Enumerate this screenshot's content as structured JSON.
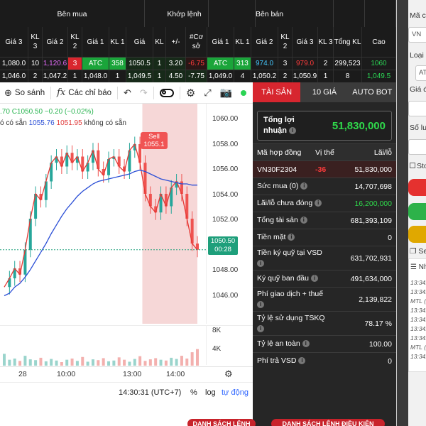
{
  "board": {
    "groups": {
      "buy": "Bên mua",
      "match": "Khớp lệnh",
      "sell": "Bên bán"
    },
    "headers": {
      "b_gia3": "Giá 3",
      "b_kl3": "KL 3",
      "b_gia2": "Giá 2",
      "b_kl2": "KL 2",
      "b_gia1": "Giá 1",
      "b_kl1": "KL 1",
      "m_gia": "Giá",
      "m_kl": "KL",
      "m_chg": "+/-",
      "m_pct": "#Cơ sở",
      "s_gia1": "Giá 1",
      "s_kl1": "KL 1",
      "s_gia2": "Giá 2",
      "s_kl2": "KL 2",
      "s_gia3": "Giá 3",
      "s_kl3": "KL 3",
      "total": "Tổng KL",
      "high": "Cao"
    },
    "rows": [
      {
        "b_gia3": "1,080.0",
        "b_kl3": "10",
        "b_gia2": "1,120.6",
        "b_kl2": "3",
        "b_gia1": "ATC",
        "b_kl1": "358",
        "m_gia": "1050.5",
        "m_kl": "1",
        "m_chg": "3.20",
        "m_pct": "-6.75",
        "s_gia1": "ATC",
        "s_kl1": "313",
        "s_gia2": "974.0",
        "s_kl2": "3",
        "s_gia3": "979.0",
        "s_kl3": "2",
        "total": "299,523",
        "high": "1060"
      },
      {
        "b_gia3": "1,046.0",
        "b_kl3": "2",
        "b_gia2": "1,047.2",
        "b_kl2": "1",
        "b_gia1": "1,048.0",
        "b_kl1": "1",
        "m_gia": "1,049.5",
        "m_kl": "1",
        "m_chg": "4.50",
        "m_pct": "-7.75",
        "s_gia1": "1,049.0",
        "s_kl1": "4",
        "s_gia2": "1,050.2",
        "s_kl2": "2",
        "s_gia3": "1,050.9",
        "s_kl3": "1",
        "total": "8",
        "high": "1,049.5"
      }
    ]
  },
  "chart": {
    "toolbar": {
      "compare": "So sánh",
      "indicators": "Các chỉ báo"
    },
    "legend1": {
      "prefix": ".70",
      "close": "C1050.50",
      "change": "−0.20 (−0.02%)"
    },
    "legend2": {
      "left": "ó có sẵn",
      "ma": "1055.76",
      "ma2": "1051.95",
      "right": "không có sẵn"
    },
    "sell_marker": {
      "label": "Sell",
      "price": "1055.1"
    },
    "y_ticks": [
      "1060.00",
      "1058.00",
      "1056.00",
      "1054.00",
      "1052.00",
      "1050.00",
      "1048.00",
      "1046.00"
    ],
    "last_price": "1050.50",
    "countdown": "00:28",
    "vol_ticks": [
      "8K",
      "4K"
    ],
    "x_ticks": [
      "28",
      "10:00",
      "13:00",
      "14:00"
    ],
    "time": "14:30:31 (UTC+7)",
    "pct": "%",
    "log": "log",
    "auto": "tự động"
  },
  "chart_data": {
    "type": "line",
    "title": "",
    "ylim": [
      1045,
      1061
    ],
    "x_ticks": [
      "28",
      "10:00",
      "13:00",
      "14:00"
    ],
    "series": [
      {
        "values": [
          1047.5,
          1048.2,
          1049.0,
          1048.5,
          1050.5,
          1053.0,
          1055.0,
          1054.5,
          1056.0,
          1057.5,
          1058.0,
          1057.2,
          1058.3,
          1057.5,
          1058.0,
          1056.8,
          1057.5,
          1058.5,
          1057.0,
          1056.5,
          1057.8,
          1058.0,
          1057.2,
          1056.8,
          1058.5,
          1059.0,
          1057.5,
          1055.0,
          1054.0,
          1053.5,
          1055.0,
          1054.0,
          1055.5,
          1056.0,
          1055.0,
          1053.0,
          1051.0,
          1050.5
        ]
      },
      {
        "values": [
          1046.8,
          1047.0,
          1047.5,
          1047.8,
          1048.3,
          1048.9,
          1049.6,
          1050.3,
          1051.0,
          1051.8,
          1052.5,
          1053.2,
          1053.8,
          1054.3,
          1054.8,
          1055.2,
          1055.5,
          1055.8,
          1056.0,
          1056.1,
          1056.2,
          1056.3,
          1056.4,
          1056.5,
          1056.6,
          1056.8,
          1056.9,
          1056.8,
          1056.6,
          1056.4,
          1056.2,
          1056.1,
          1056.0,
          1055.9,
          1055.8,
          1055.8,
          1055.7,
          1055.7
        ]
      }
    ],
    "volume": [
      3000,
      1500,
      1800,
      1200,
      2500,
      1600,
      1400,
      2000,
      1100,
      1700,
      1300,
      900,
      1500,
      1800,
      1200,
      2200,
      1000,
      1600,
      1400,
      1900,
      1100,
      1300,
      2100,
      1500,
      1000,
      1700,
      2400,
      1200,
      1600,
      1900,
      1500,
      1300,
      2000,
      1700,
      2500,
      1800,
      3400,
      4200
    ]
  },
  "assets": {
    "tabs": [
      "TÀI SẢN",
      "10 GIÁ",
      "AUTO BOT"
    ],
    "pnl_label1": "Tổng lợi",
    "pnl_label2": "nhuận",
    "pnl_value": "51,830,000",
    "head": {
      "contract": "Mã hợp đồng",
      "position": "Vị thế",
      "pl": "Lãi/lỗ"
    },
    "contract": {
      "code": "VN30F2304",
      "position": "-36",
      "pl": "51,830,000"
    },
    "rows": [
      {
        "label": "Sức mua (0)",
        "value": "14,707,698",
        "info": true
      },
      {
        "label": "Lãi/lỗ chưa đóng",
        "value": "16,200,000",
        "info": true,
        "green": true
      },
      {
        "label": "Tổng tài sản",
        "value": "681,393,109",
        "info": true
      },
      {
        "label": "Tiền mặt",
        "value": "0",
        "info": true
      },
      {
        "label": "Tiền ký quỹ tại VSD",
        "value": "631,702,931",
        "info": true,
        "tall": true
      },
      {
        "label": "Ký quỹ ban đầu",
        "value": "491,634,000",
        "info": true
      },
      {
        "label": "Phí giao dịch + thuế",
        "value": "2,139,822",
        "info": true,
        "tall": true
      },
      {
        "label": "Tỷ lệ sử dụng TSKQ",
        "value": "78.17 %",
        "info": true,
        "tall": true
      },
      {
        "label": "Tỷ lệ an toàn",
        "value": "100.00",
        "info": true
      },
      {
        "label": "Phí trả VSD",
        "value": "0",
        "info": true
      }
    ],
    "info_glyph": "i"
  },
  "order": {
    "label_code": "Mã ch",
    "box_code": "VN",
    "label_type": "Loại l",
    "box_type": "ATC",
    "label_price": "Giá đ",
    "label_qty": "Số lư",
    "label_stop": "Stop l",
    "label_semi": "Semi-",
    "label_log": "Nhật k",
    "logs": [
      "13:34:1",
      "13:34:1",
      "MTL (10",
      "13:34:1",
      "13:34:1",
      "13:34:1",
      "13:34:1",
      "MTL (10",
      "13:34:2"
    ]
  },
  "bottom_buttons": [
    "DANH SÁCH LỆNH",
    "DANH SÁCH LỆNH ĐIỀU KIỆN"
  ]
}
